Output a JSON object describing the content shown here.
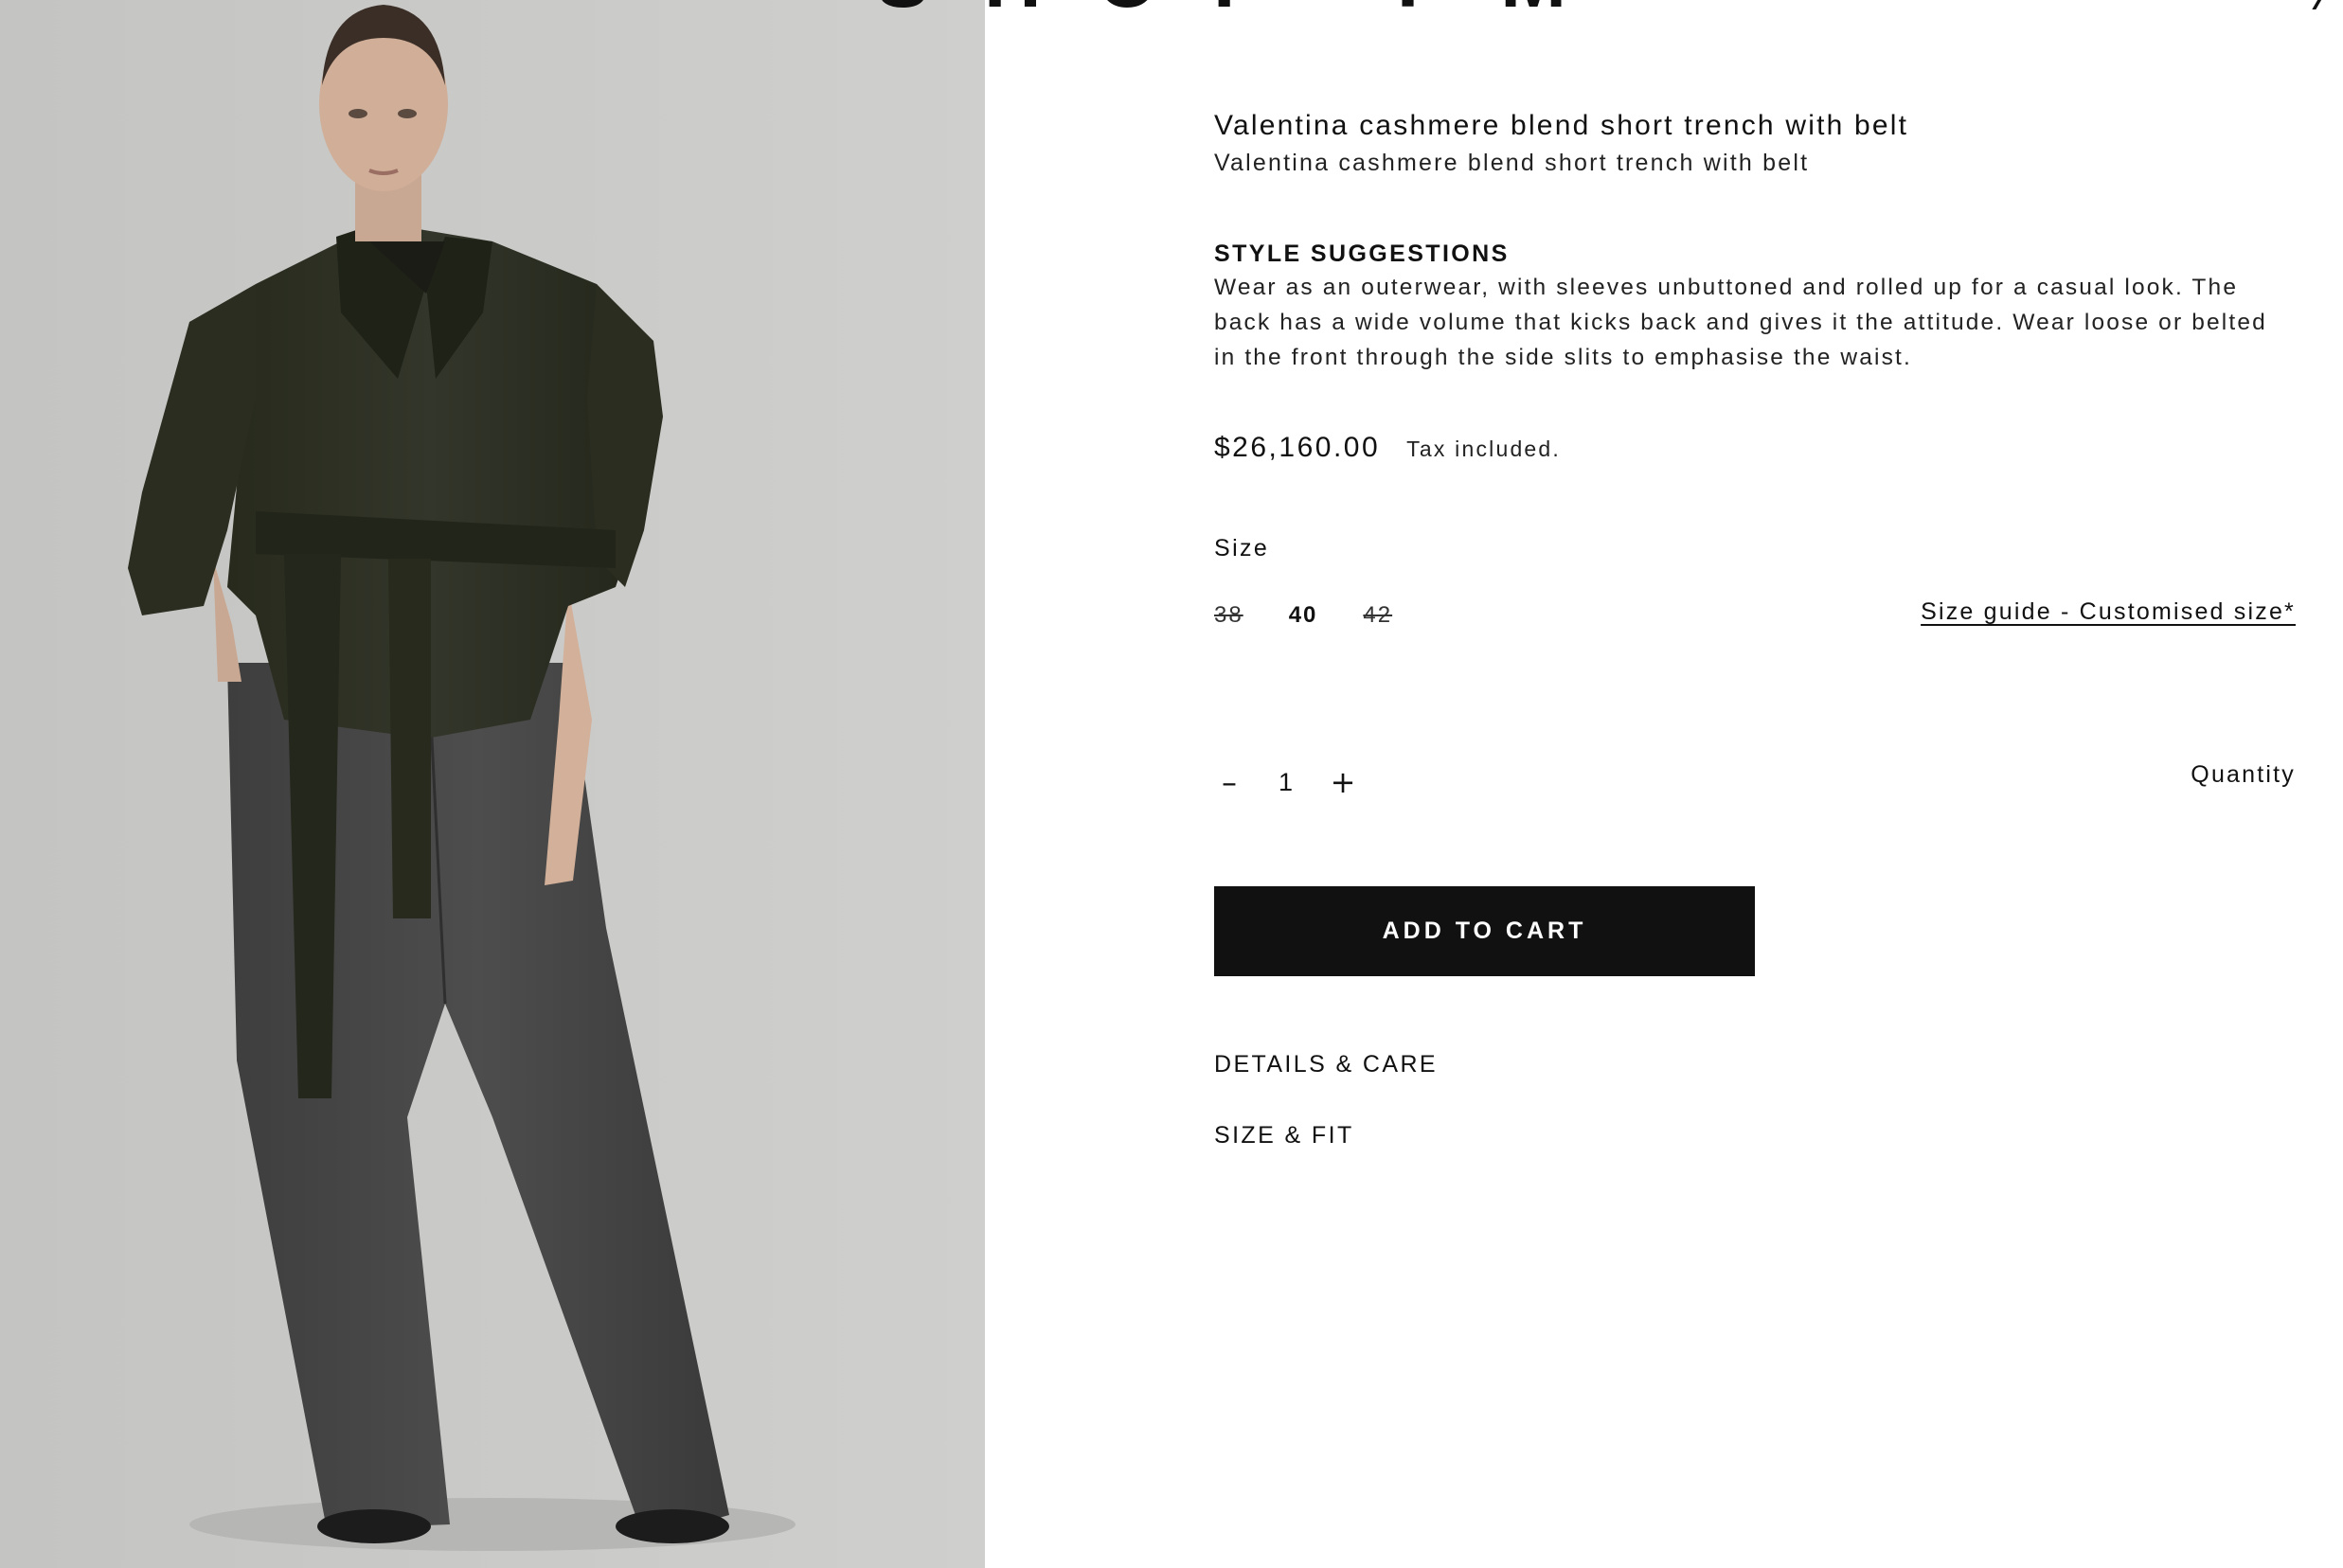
{
  "header": {
    "brand_fragment": "SHOP FM"
  },
  "product": {
    "title": "Valentina cashmere blend short trench with belt",
    "subtitle": "Valentina cashmere blend short trench with belt",
    "image_description": "model wearing dark green short trench with belt and grey wide-leg trousers",
    "style_suggestions": {
      "heading": "STYLE SUGGESTIONS",
      "text": "Wear as an outerwear, with sleeves unbuttoned and rolled up for a casual look. The back has a wide volume that kicks back and gives it the attitude. Wear loose or belted in the front through the side slits to emphasise the waist."
    },
    "price": "$26,160.00",
    "tax_note": "Tax included.",
    "size": {
      "label": "Size",
      "options": [
        {
          "label": "38",
          "available": false
        },
        {
          "label": "40",
          "available": true
        },
        {
          "label": "42",
          "available": false
        }
      ],
      "guide_link": "Size guide - Customised size*"
    },
    "quantity": {
      "label": "Quantity",
      "value": "1",
      "decrement_symbol": "–",
      "increment_symbol": "+"
    },
    "add_to_cart_label": "ADD TO CART",
    "accordions": [
      {
        "label": "DETAILS & CARE"
      },
      {
        "label": "SIZE & FIT"
      }
    ]
  },
  "colors": {
    "button_bg": "#111111",
    "button_text": "#ffffff",
    "photo_bg": "#c9c9c7",
    "coat": "#2b2d1f",
    "trousers": "#4a4a4a"
  }
}
